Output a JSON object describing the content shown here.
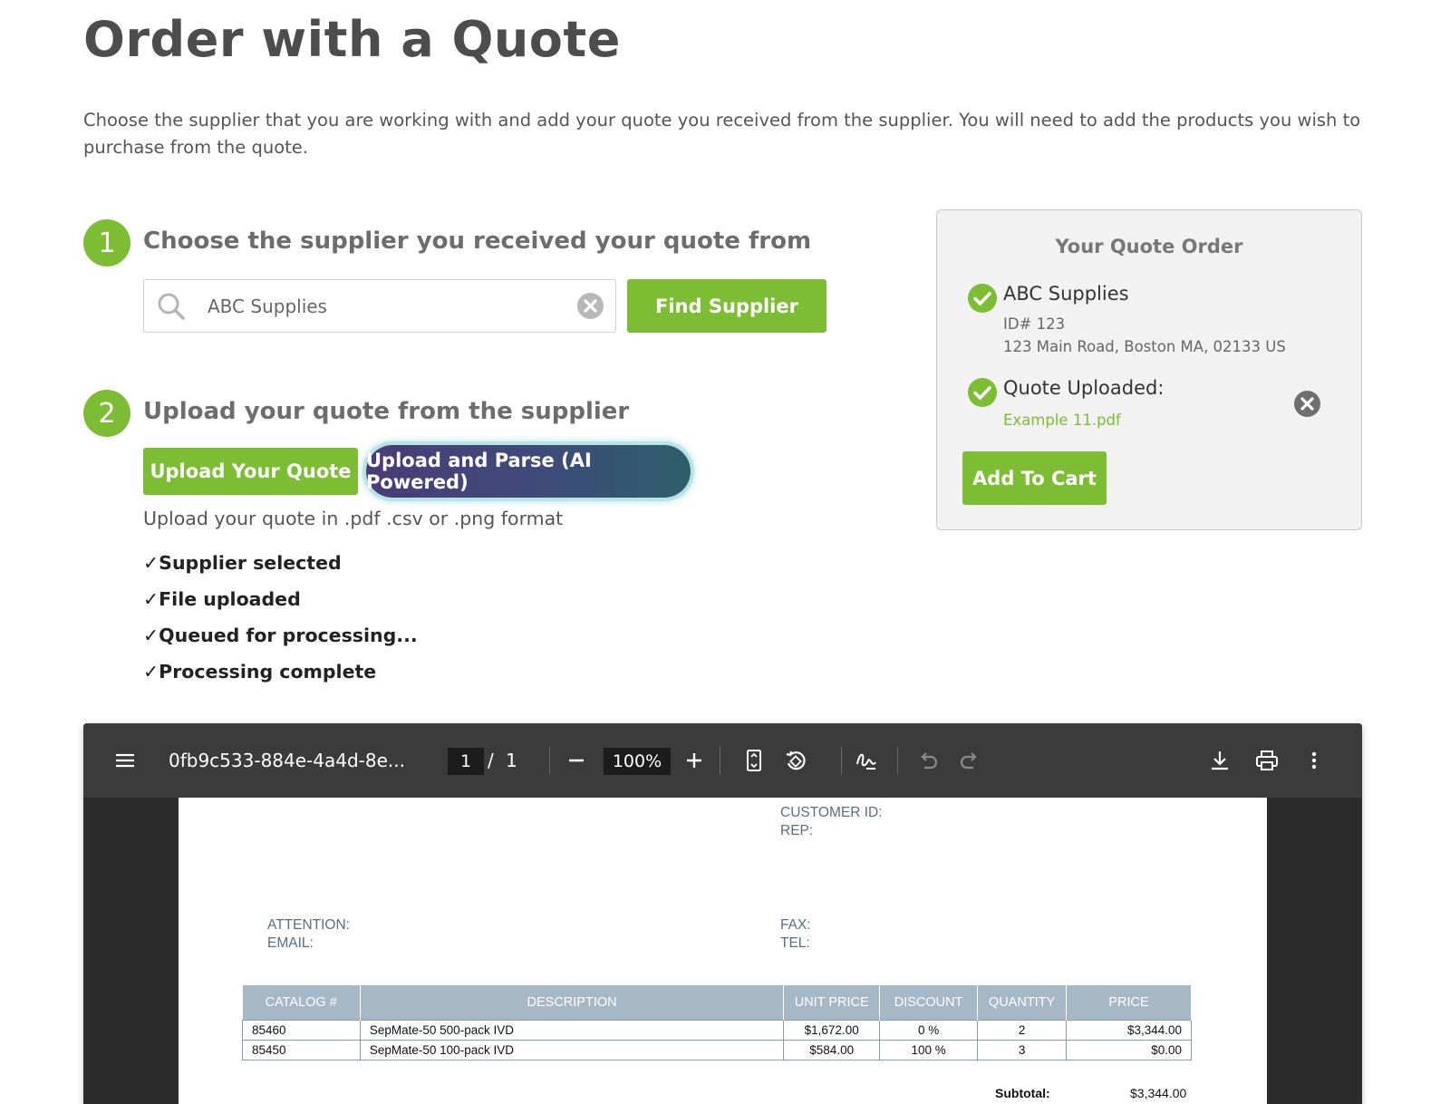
{
  "page": {
    "title": "Order with a Quote",
    "intro": "Choose the supplier that you are working with and add your quote you received from the supplier. You will need to add the products you wish to purchase from the quote."
  },
  "step1": {
    "number": "1",
    "title": "Choose the supplier you received your quote from",
    "search_value": "ABC Supplies",
    "find_label": "Find Supplier"
  },
  "step2": {
    "number": "2",
    "title": "Upload your quote from the supplier",
    "upload_label": "Upload Your Quote",
    "parse_label": "Upload and Parse (AI Powered)",
    "format_hint": "Upload your quote in .pdf .csv or .png format",
    "status": [
      "✓Supplier selected",
      "✓File uploaded",
      "✓Queued for processing...",
      "✓Processing complete"
    ]
  },
  "panel": {
    "title": "Your Quote Order",
    "supplier_name": "ABC Supplies",
    "supplier_id": "ID# 123",
    "supplier_address": "123 Main Road, Boston MA, 02133 US",
    "quote_label": "Quote Uploaded:",
    "quote_file": "Example 11.pdf",
    "cart_label": "Add To Cart"
  },
  "viewer": {
    "filename": "0fb9c533-884e-4a4d-8e...",
    "page_current": "1",
    "page_sep": "/",
    "page_total": "1",
    "zoom": "100%",
    "icons": {
      "menu": "menu-icon",
      "zoom_out": "minus-icon",
      "zoom_in": "plus-icon",
      "fit": "fit-page-icon",
      "rotate": "rotate-icon",
      "annotate": "signature-icon",
      "undo": "undo-icon",
      "redo": "redo-icon",
      "download": "download-icon",
      "print": "print-icon",
      "more": "more-icon"
    }
  },
  "document": {
    "customer_id_label": "CUSTOMER ID:",
    "rep_label": "REP:",
    "attention_label": "ATTENTION:",
    "email_label": "EMAIL:",
    "fax_label": "FAX:",
    "tel_label": "TEL:",
    "columns": [
      "CATALOG #",
      "DESCRIPTION",
      "UNIT PRICE",
      "DISCOUNT",
      "QUANTITY",
      "PRICE"
    ],
    "rows": [
      [
        "85460",
        "SepMate-50 500-pack IVD",
        "$1,672.00",
        "0 %",
        "2",
        "$3,344.00"
      ],
      [
        "85450",
        "SepMate-50 100-pack IVD",
        "$584.00",
        "100 %",
        "3",
        "$0.00"
      ]
    ],
    "subtotal_label": "Subtotal:",
    "subtotal_value": "$3,344.00"
  },
  "colors": {
    "accent_green": "#7cbd34",
    "ai_gradient_start": "#4a3c78",
    "ai_gradient_end": "#2e5e6a"
  }
}
